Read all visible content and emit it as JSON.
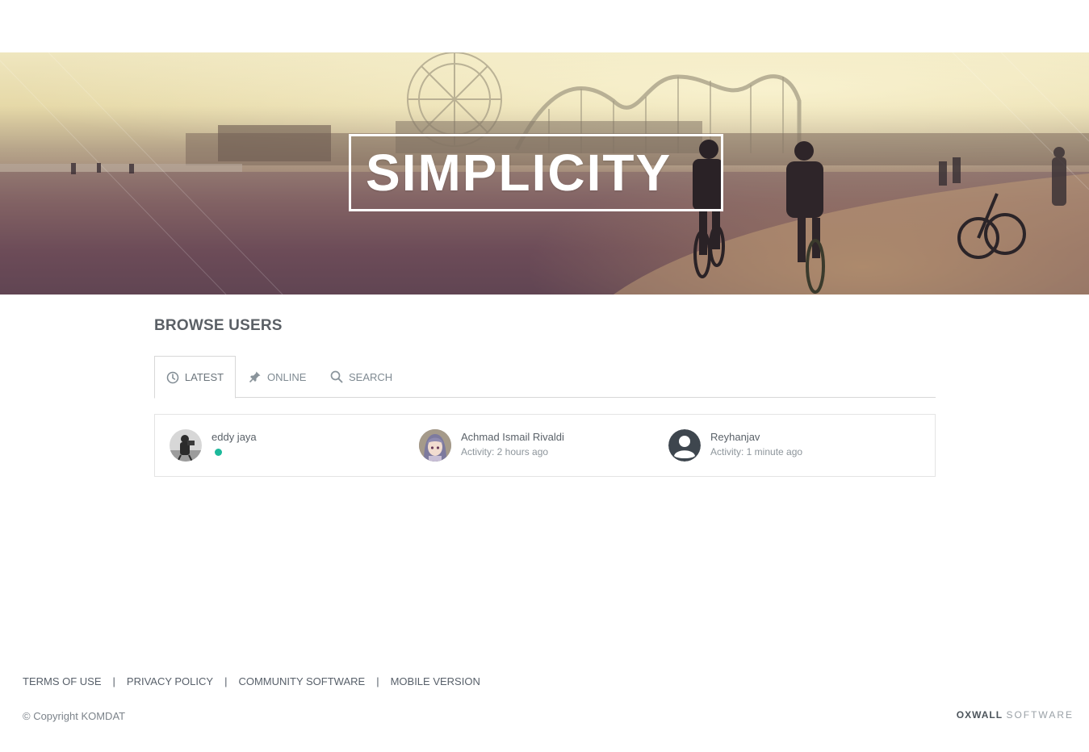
{
  "header": {
    "logo_text": "SIMPLICITY"
  },
  "main": {
    "page_title": "BROWSE USERS",
    "tabs": [
      {
        "label": "LATEST",
        "icon": "clock-icon",
        "active": true
      },
      {
        "label": "ONLINE",
        "icon": "pin-icon",
        "active": false
      },
      {
        "label": "SEARCH",
        "icon": "search-icon",
        "active": false
      }
    ],
    "users": [
      {
        "name": "eddy jaya",
        "activity": "",
        "online": true,
        "avatar": "photo-avatar"
      },
      {
        "name": "Achmad Ismail Rivaldi",
        "activity": "Activity: 2 hours ago",
        "online": false,
        "avatar": "anime-avatar"
      },
      {
        "name": "Reyhanjav",
        "activity": "Activity: 1 minute ago",
        "online": false,
        "avatar": "default-user-avatar"
      }
    ]
  },
  "footer": {
    "links": [
      "TERMS OF USE",
      "PRIVACY POLICY",
      "COMMUNITY SOFTWARE",
      "MOBILE VERSION"
    ],
    "separator": "|",
    "copyright": "© Copyright KOMDAT",
    "powered_brand": "OXWALL",
    "powered_suffix": "SOFTWARE"
  },
  "colors": {
    "online_dot": "#1cb99b",
    "text_dark": "#5b6066",
    "border": "#d8d8d8"
  }
}
